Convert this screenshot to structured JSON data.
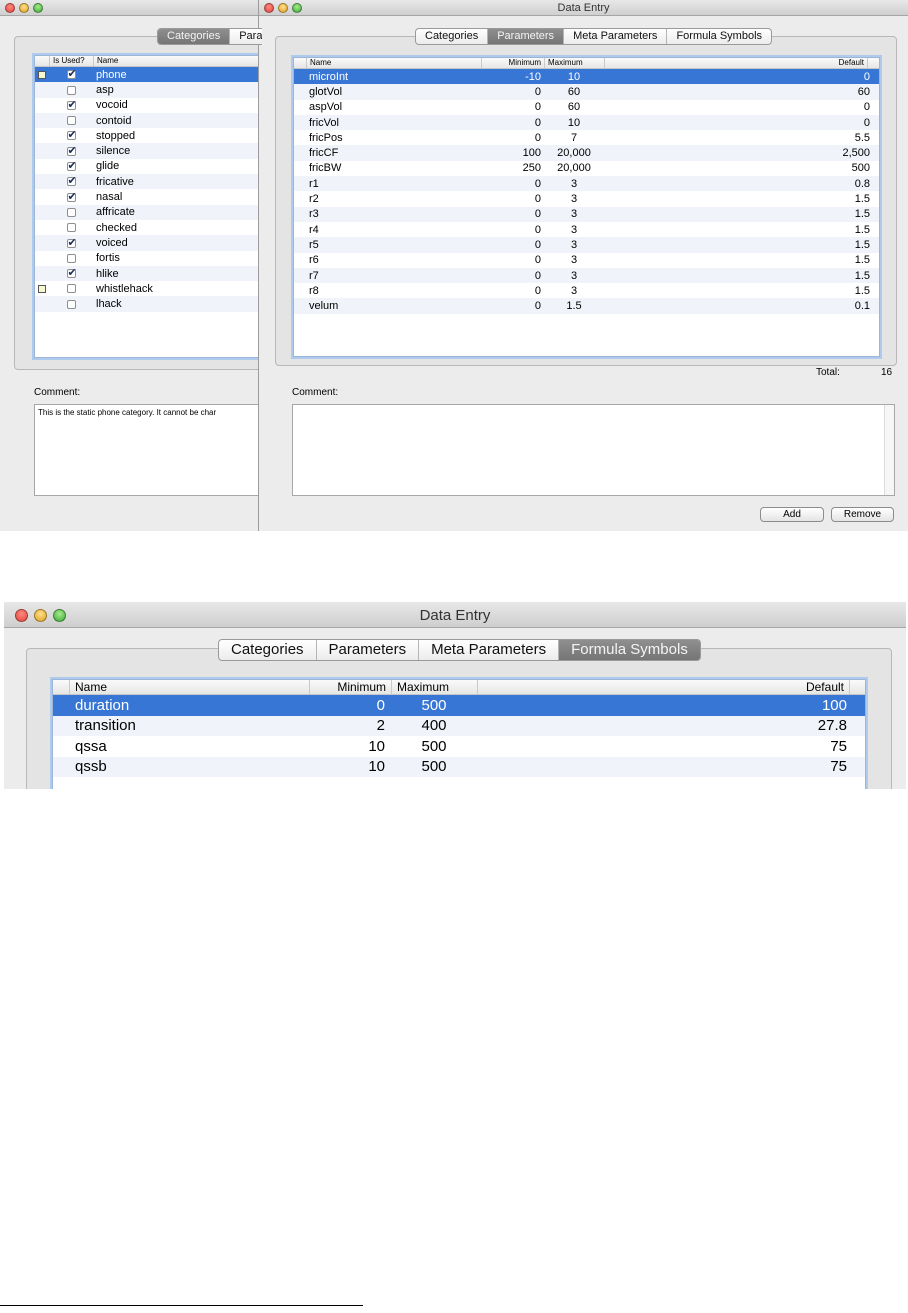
{
  "win1": {
    "tabs": [
      "Categories",
      "Para"
    ],
    "columns": [
      "",
      "Is Used?",
      "Name"
    ],
    "rows": [
      {
        "note": true,
        "used": true,
        "name": "phone",
        "selected": true
      },
      {
        "note": false,
        "used": false,
        "name": "asp"
      },
      {
        "note": false,
        "used": true,
        "name": "vocoid"
      },
      {
        "note": false,
        "used": false,
        "name": "contoid"
      },
      {
        "note": false,
        "used": true,
        "name": "stopped"
      },
      {
        "note": false,
        "used": true,
        "name": "silence"
      },
      {
        "note": false,
        "used": true,
        "name": "glide"
      },
      {
        "note": false,
        "used": true,
        "name": "fricative"
      },
      {
        "note": false,
        "used": true,
        "name": "nasal"
      },
      {
        "note": false,
        "used": false,
        "name": "affricate"
      },
      {
        "note": false,
        "used": false,
        "name": "checked"
      },
      {
        "note": false,
        "used": true,
        "name": "voiced"
      },
      {
        "note": false,
        "used": false,
        "name": "fortis"
      },
      {
        "note": false,
        "used": true,
        "name": "hlike"
      },
      {
        "note": true,
        "used": false,
        "name": "whistlehack"
      },
      {
        "note": false,
        "used": false,
        "name": "lhack"
      }
    ],
    "comment_label": "Comment:",
    "comment_text": "This is the static phone category.  It cannot be char"
  },
  "win2": {
    "title": "Data Entry",
    "tabs": [
      "Categories",
      "Parameters",
      "Meta Parameters",
      "Formula Symbols"
    ],
    "selected_tab": 1,
    "columns": [
      "Name",
      "Minimum",
      "Maximum",
      "Default"
    ],
    "rows": [
      [
        "microInt",
        "-10",
        "10",
        "0"
      ],
      [
        "glotVol",
        "0",
        "60",
        "60"
      ],
      [
        "aspVol",
        "0",
        "60",
        "0"
      ],
      [
        "fricVol",
        "0",
        "10",
        "0"
      ],
      [
        "fricPos",
        "0",
        "7",
        "5.5"
      ],
      [
        "fricCF",
        "100",
        "20,000",
        "2,500"
      ],
      [
        "fricBW",
        "250",
        "20,000",
        "500"
      ],
      [
        "r1",
        "0",
        "3",
        "0.8"
      ],
      [
        "r2",
        "0",
        "3",
        "1.5"
      ],
      [
        "r3",
        "0",
        "3",
        "1.5"
      ],
      [
        "r4",
        "0",
        "3",
        "1.5"
      ],
      [
        "r5",
        "0",
        "3",
        "1.5"
      ],
      [
        "r6",
        "0",
        "3",
        "1.5"
      ],
      [
        "r7",
        "0",
        "3",
        "1.5"
      ],
      [
        "r8",
        "0",
        "3",
        "1.5"
      ],
      [
        "velum",
        "0",
        "1.5",
        "0.1"
      ]
    ],
    "total_label": "Total:",
    "total_value": "16",
    "comment_label": "Comment:",
    "add_label": "Add",
    "remove_label": "Remove"
  },
  "win3": {
    "title": "Data Entry",
    "tabs": [
      "Categories",
      "Parameters",
      "Meta Parameters",
      "Formula Symbols"
    ],
    "selected_tab": 3,
    "columns": [
      "Name",
      "Minimum",
      "Maximum",
      "Default"
    ],
    "rows": [
      [
        "duration",
        "0",
        "500",
        "100"
      ],
      [
        "transition",
        "2",
        "400",
        "27.8"
      ],
      [
        "qssa",
        "10",
        "500",
        "75"
      ],
      [
        "qssb",
        "10",
        "500",
        "75"
      ]
    ]
  }
}
